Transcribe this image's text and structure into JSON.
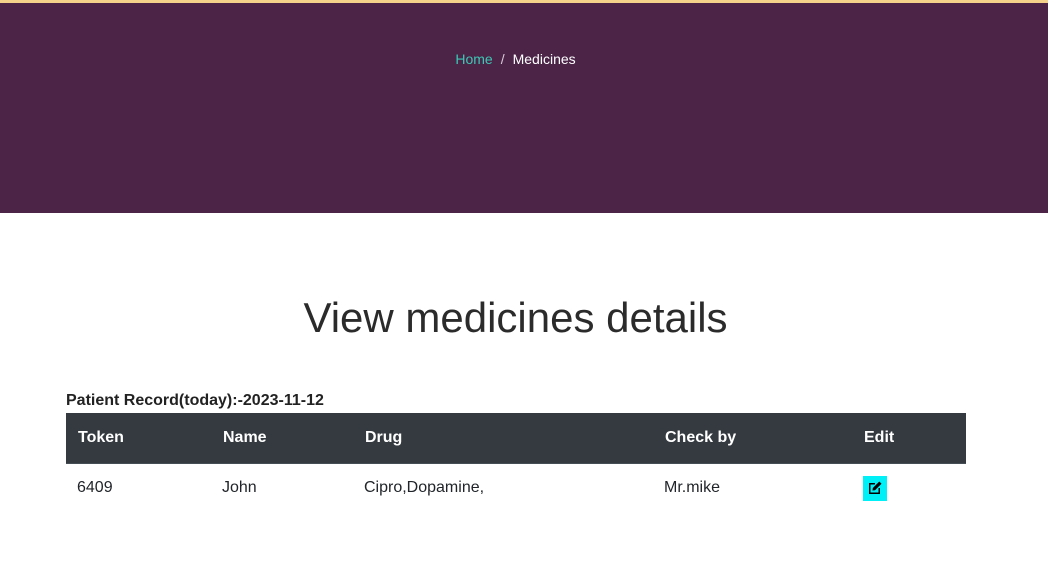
{
  "colors": {
    "hero_background": "#4b2448",
    "top_accent": "#f5d28a",
    "breadcrumb_link": "#3cc8b4",
    "table_header": "#343a40",
    "edit_button": "#00f0f8"
  },
  "breadcrumb": {
    "home_label": "Home",
    "separator": "/",
    "current_label": "Medicines"
  },
  "page_title": "View medicines details",
  "record_caption": "Patient Record(today):-2023-11-12",
  "table": {
    "headers": {
      "token": "Token",
      "name": "Name",
      "drug": "Drug",
      "check_by": "Check by",
      "edit": "Edit"
    },
    "rows": [
      {
        "token": "6409",
        "name": "John",
        "drug": "Cipro,Dopamine,",
        "check_by": "Mr.mike",
        "edit_icon": "edit-icon"
      }
    ]
  }
}
